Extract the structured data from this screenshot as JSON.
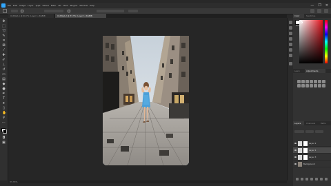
{
  "menubar": {
    "items": [
      "File",
      "Edit",
      "Image",
      "Layer",
      "Type",
      "Select",
      "Filter",
      "3D",
      "View",
      "Plugins",
      "Window",
      "Help"
    ],
    "window_controls": [
      "—",
      "❐",
      "✕"
    ]
  },
  "document_tabs": [
    {
      "label": "Untitled-1 @ 66.7% (Layer 1, RGB/8)",
      "active": false
    },
    {
      "label": "Untitled-2 @ 33.3% (Layer 1, RGB/8)",
      "active": true
    }
  ],
  "options_bar": {
    "tool_icon": "move-tool-icon"
  },
  "status_bar": {
    "zoom": "33.33%"
  },
  "panels": {
    "top_tabs": [
      "Color",
      "Swatches"
    ],
    "adjust_tabs": [
      "Learn",
      "Adjustments"
    ],
    "layers_tabs": [
      "Layers",
      "Channels",
      "Paths"
    ],
    "layers": [
      {
        "name": "Layer 2",
        "selected": false
      },
      {
        "name": "Layer 1",
        "selected": true
      },
      {
        "name": "Layer 3",
        "selected": false
      },
      {
        "name": "Background",
        "selected": false
      }
    ]
  },
  "colors": {
    "accent": "#31a8ff",
    "foreground": "#ffffff",
    "background": "#000000",
    "picker_hue": "#e0101a"
  }
}
